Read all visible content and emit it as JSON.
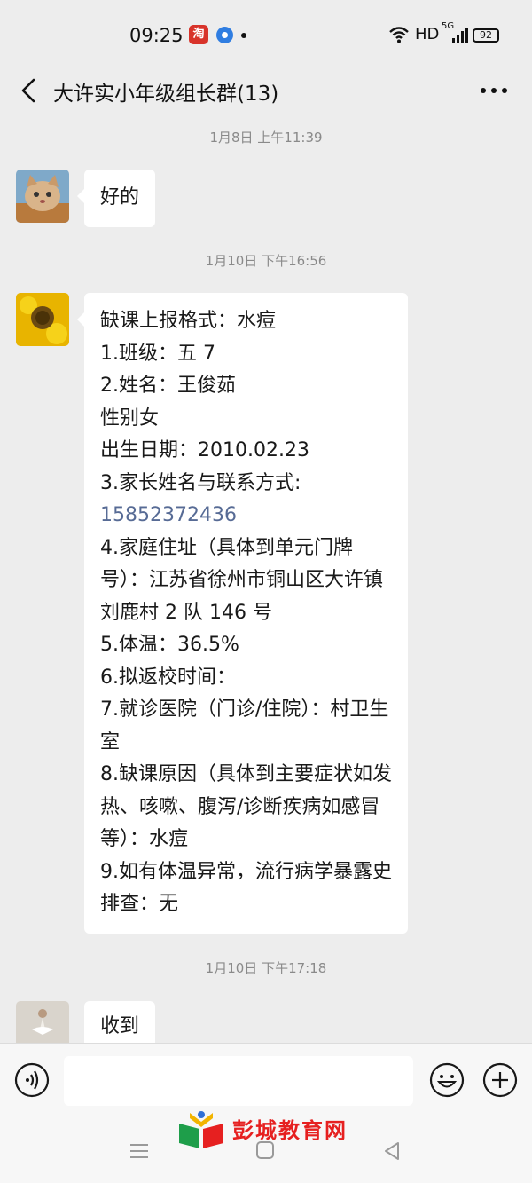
{
  "status_bar": {
    "time": "09:25",
    "app_icon_text": "淘",
    "hd": "HD",
    "network": "5G",
    "battery": "92"
  },
  "header": {
    "title": "大许实小年级组长群(13)"
  },
  "messages": [
    {
      "timestamp": "1月8日 上午11:39"
    },
    {
      "lines": [
        "好的"
      ]
    },
    {
      "timestamp": "1月10日 下午16:56"
    },
    {
      "lines": [
        "缺课上报格式：水痘",
        "1.班级：五 7",
        "2.姓名：王俊茹",
        "性别女",
        "出生日期：2010.02.23",
        "3.家长姓名与联系方式:",
        "15852372436",
        "4.家庭住址（具体到单元门牌",
        "号）：江苏省徐州市铜山区大许镇",
        "刘鹿村 2 队 146 号",
        "5.体温：36.5%",
        "6.拟返校时间：",
        "7.就诊医院（门诊/住院）：村卫生",
        "室",
        "8.缺课原因（具体到主要症状如发",
        "热、咳嗽、腹泻/诊断疾病如感冒",
        "等）：水痘",
        "9.如有体温异常，流行病学暴露史",
        "排查：无"
      ]
    },
    {
      "timestamp": "1月10日 下午17:18"
    },
    {
      "lines": [
        "收到"
      ]
    }
  ],
  "watermark": {
    "text": "彭城教育网"
  },
  "colors": {
    "background": "#ededed",
    "bubble": "#ffffff",
    "link": "#576b95",
    "timestamp": "#8a8a8a",
    "watermark": "#e62020"
  },
  "icons": [
    "back-arrow-icon",
    "more-dots-icon",
    "voice-icon",
    "emoji-icon",
    "plus-icon",
    "menu-icon",
    "home-icon",
    "back-triangle-icon",
    "wifi-icon",
    "signal-icon"
  ]
}
